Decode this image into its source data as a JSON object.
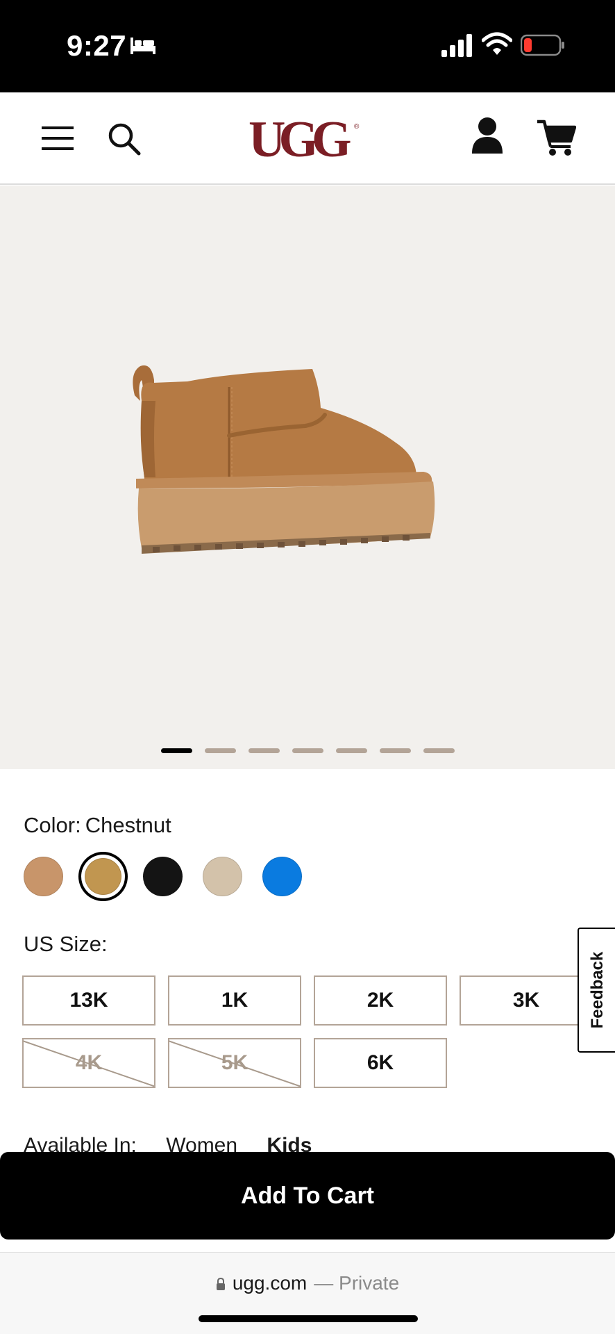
{
  "status_bar": {
    "time": "9:27"
  },
  "header": {
    "logo_text": "UGG",
    "brand_color": "#7b1e25"
  },
  "gallery": {
    "image_alt": "Classic Ultra Mini Platform boot in Chestnut",
    "page_count": 7,
    "active_page": 1
  },
  "color": {
    "label": "Color:",
    "value": "Chestnut",
    "swatches": [
      {
        "name": "swatch-1",
        "hex": "#c8956a"
      },
      {
        "name": "swatch-2",
        "hex": "#c19650",
        "selected": true
      },
      {
        "name": "swatch-3",
        "hex": "#141414"
      },
      {
        "name": "swatch-4",
        "hex": "#d3c2aa"
      },
      {
        "name": "swatch-5",
        "hex": "#0a7be0"
      }
    ]
  },
  "size": {
    "label": "US Size:",
    "options": [
      {
        "label": "13K",
        "available": true
      },
      {
        "label": "1K",
        "available": true
      },
      {
        "label": "2K",
        "available": true
      },
      {
        "label": "3K",
        "available": true
      },
      {
        "label": "4K",
        "available": false
      },
      {
        "label": "5K",
        "available": false
      },
      {
        "label": "6K",
        "available": true
      }
    ]
  },
  "feedback": {
    "label": "Feedback"
  },
  "available_in": {
    "label": "Available In:",
    "options": [
      "Women",
      "Kids"
    ]
  },
  "cta": {
    "add_to_cart": "Add To Cart"
  },
  "browser": {
    "domain": "ugg.com",
    "private_label": "— Private"
  }
}
